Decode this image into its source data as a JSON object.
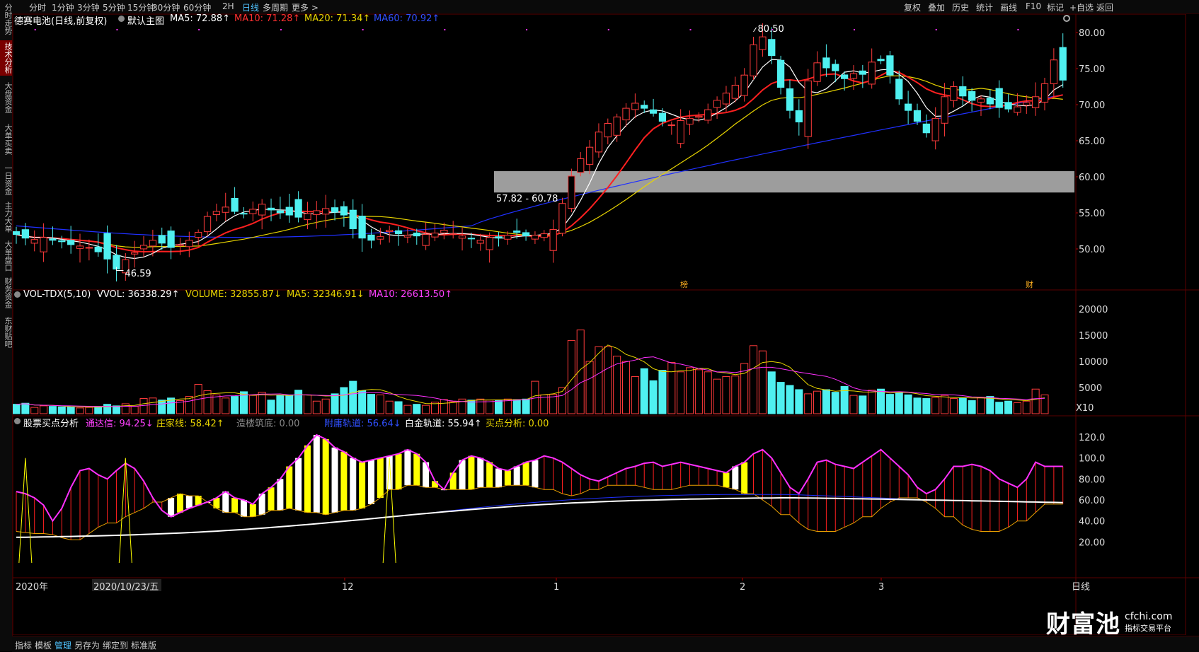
{
  "left_tabs": [
    "分时走势",
    "技术分析",
    "大盘资金",
    "大单买卖",
    "一日资金",
    "主力大单",
    "大单盘口",
    "财务资金",
    "东财贴吧"
  ],
  "top_tabs": [
    "分时",
    "1分钟",
    "3分钟",
    "5分钟",
    "15分钟",
    "30分钟",
    "60分钟",
    "2H",
    "日线",
    "多周期",
    "更多 >"
  ],
  "top_right": [
    "复权",
    "叠加",
    "历史",
    "统计",
    "画线",
    "F10",
    "标记",
    "+自选",
    "返回"
  ],
  "main_legend": {
    "title": "德赛电池(日线,前复权)",
    "indicator": "默认主图",
    "ma5": "MA5: 72.88↑",
    "ma10": "MA10: 71.28↑",
    "ma20": "MA20: 71.34↑",
    "ma60": "MA60: 70.92↑"
  },
  "vol_legend": {
    "name": "VOL-TDX(5,10)",
    "vvol": "VVOL: 36338.29↑",
    "volume": "VOLUME: 32855.87↓",
    "ma5": "MA5: 32346.91↓",
    "ma10": "MA10: 26613.50↑"
  },
  "ind_legend": {
    "name": "股票买点分析",
    "tongda": "通达信: 94.25↓",
    "zhuangjia": "庄家线: 58.42↑",
    "zaolou": "造楼筑底: 0.00",
    "fuwei": "附庸轨道: 56.64↓",
    "baijin": "白金轨道: 55.94↑",
    "maidian": "买点分析: 0.00"
  },
  "annotations": {
    "high": "80.50",
    "low": "46.59",
    "band": "57.82 - 60.78",
    "marker1": "榜",
    "marker2": "财"
  },
  "price_axis": [
    "80.00",
    "75.00",
    "70.00",
    "65.00",
    "60.00",
    "55.00",
    "50.00"
  ],
  "vol_axis": [
    "20000",
    "15000",
    "10000",
    "5000",
    "X10"
  ],
  "ind_axis": [
    "120.0",
    "100.0",
    "80.00",
    "60.00",
    "40.00",
    "20.00"
  ],
  "date_axis": [
    "2020年",
    "2020/10/23/五",
    "12",
    "1",
    "2",
    "3",
    "日线"
  ],
  "bottom_tabs": [
    "指标",
    "模板",
    "管理",
    "另存为",
    "绑定到",
    "标准版"
  ],
  "logo": {
    "main": "财富池",
    "domain": "cfchi.com",
    "sub": "指标交易平台"
  },
  "colors": {
    "up": "#ff3b3b",
    "down": "#4ff0f0",
    "ma5": "#ffffff",
    "ma10": "#ff2020",
    "ma20": "#e8d400",
    "ma60": "#2030ff",
    "band": "#b8b8b8",
    "magenta": "#ff30ff"
  },
  "chart_data": {
    "type": "candlestick",
    "n": 114,
    "price_ylim": [
      44,
      82
    ],
    "vol_ylim": [
      0,
      22000
    ],
    "ind_ylim": [
      0,
      130
    ],
    "closes": [
      52,
      51.5,
      51.3,
      51.6,
      51.2,
      51,
      50.6,
      50.4,
      50.2,
      49.6,
      48.6,
      47.2,
      48.5,
      49.5,
      50.5,
      51.2,
      50.8,
      50.2,
      50.6,
      51.2,
      52.3,
      54.5,
      55.2,
      55.8,
      55.2,
      54.9,
      55.5,
      56.2,
      55.4,
      55,
      54.7,
      54.4,
      54.9,
      55.3,
      55.6,
      55.1,
      54.7,
      52.8,
      51.5,
      51.2,
      51.7,
      52.6,
      52.1,
      51.9,
      51.8,
      52,
      52.2,
      52.6,
      52.1,
      51.8,
      51.4,
      51.2,
      51.6,
      51.5,
      51.9,
      52.3,
      51.8,
      51.9,
      52.1,
      52.7,
      56.3,
      60.1,
      62.5,
      64.1,
      66.2,
      67.4,
      68.3,
      69.5,
      70.2,
      69.5,
      68.8,
      67.7,
      67.2,
      67.8,
      68.1,
      68.4,
      69.3,
      70.6,
      71.6,
      72.7,
      74.1,
      78.3,
      79.4,
      76.8,
      72.4,
      69.2,
      67.6,
      73.3,
      75.8,
      75.1,
      74.7,
      73.6,
      74.3,
      74.2,
      75.9,
      76.1,
      74.1,
      70.8,
      69.2,
      67.7,
      66.1,
      68.1,
      71.1,
      72.5,
      71.2,
      70.6,
      70.8,
      70.1,
      69.6,
      69.4,
      69.7,
      70.3,
      71.1,
      72.9,
      76.2,
      73.4
    ],
    "volumes": [
      1800,
      2000,
      1200,
      1500,
      1400,
      1300,
      1300,
      1100,
      1200,
      1300,
      1800,
      1500,
      1900,
      1400,
      2900,
      3000,
      2600,
      3000,
      2500,
      3300,
      5600,
      4400,
      3600,
      3000,
      3300,
      4200,
      3500,
      4100,
      2600,
      3500,
      3600,
      4500,
      3600,
      2400,
      2800,
      3800,
      5000,
      6200,
      4400,
      3700,
      3600,
      2400,
      2300,
      1600,
      1800,
      1600,
      2200,
      2700,
      2300,
      2800,
      2600,
      2800,
      2600,
      2500,
      2800,
      2700,
      2800,
      6200,
      3600,
      3700,
      5000,
      14000,
      16000,
      10000,
      12800,
      12800,
      11000,
      10000,
      7100,
      8600,
      6300,
      8300,
      9800,
      8000,
      8800,
      8400,
      8000,
      6600,
      7100,
      7200,
      9600,
      13000,
      12000,
      8000,
      6000,
      5400,
      4600,
      3800,
      4300,
      4600,
      4100,
      5200,
      3500,
      3400,
      4500,
      4700,
      3700,
      4000,
      3600,
      3000,
      2900,
      3100,
      3500,
      2900,
      3000,
      2500,
      3100,
      3300,
      2200,
      2400,
      2100,
      2400,
      4700,
      3600
    ],
    "ma_close_last": {
      "ma5": 72.88,
      "ma10": 71.28,
      "ma20": 71.34,
      "ma60": 70.92
    }
  }
}
